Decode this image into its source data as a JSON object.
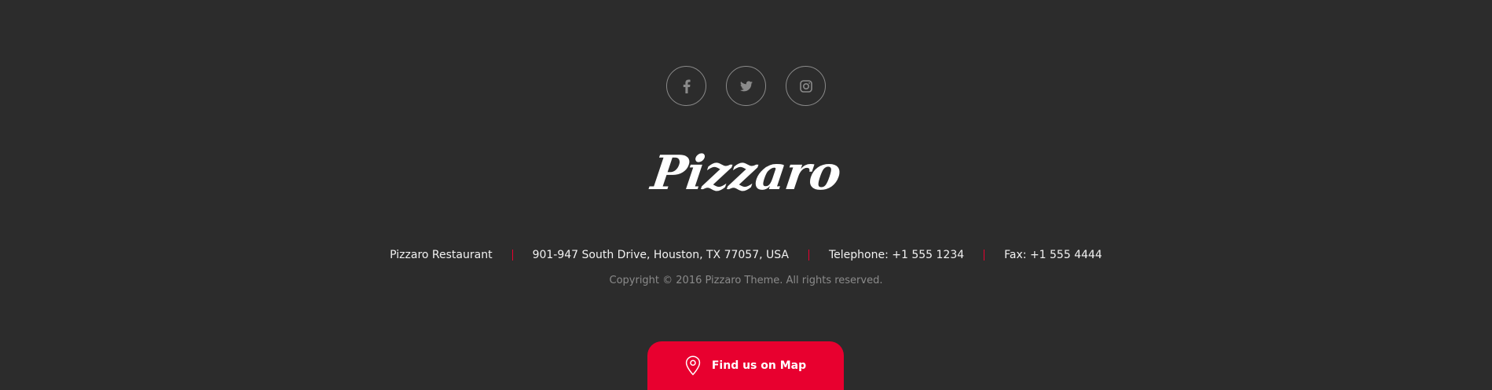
{
  "social": [
    {
      "icon": "facebook-icon",
      "label": "f"
    },
    {
      "icon": "twitter-icon"
    },
    {
      "icon": "instagram-icon"
    }
  ],
  "brand": {
    "logo_text": "Pizzaro"
  },
  "contact": {
    "name": "Pizzaro Restaurant",
    "address": "901-947 South Drive, Houston, TX 77057, USA",
    "telephone": "Telephone: +1 555 1234",
    "fax": "Fax: +1 555 4444"
  },
  "copyright": "Copyright © 2016 Pizzaro Theme. All rights reserved.",
  "map_button": {
    "label": "Find us on Map",
    "icon": "map-pin-icon"
  },
  "colors": {
    "background": "#2c2c2c",
    "accent": "#e8002f",
    "text": "#f2f2f2",
    "muted": "#8b8b8b",
    "icon": "#8a8a8a"
  }
}
